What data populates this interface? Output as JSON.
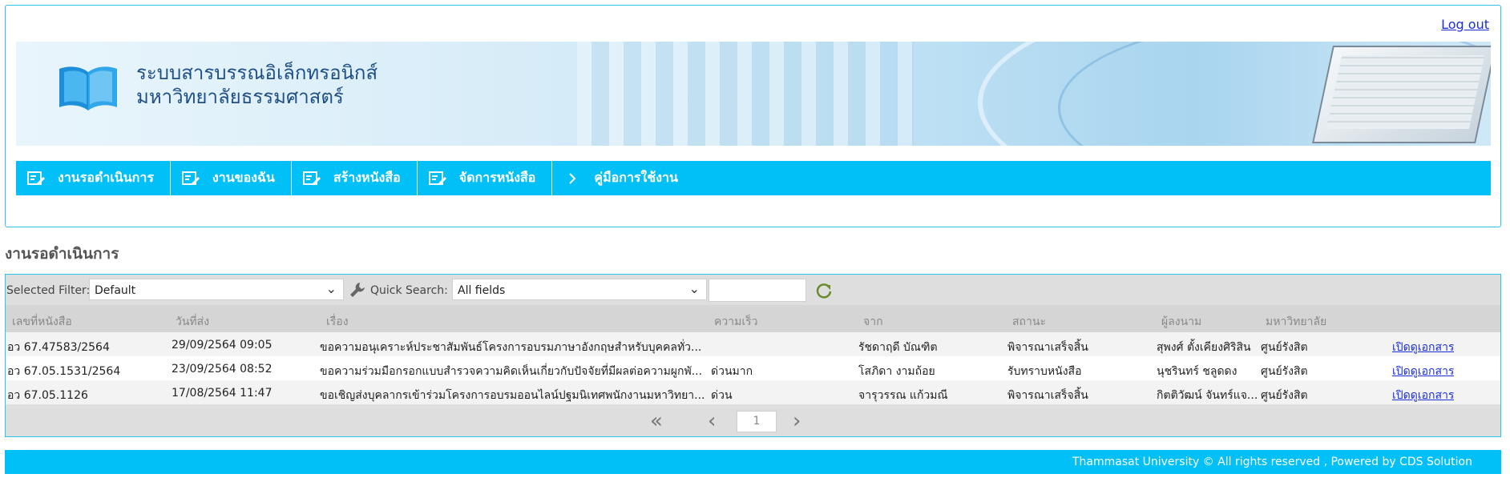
{
  "header": {
    "logout_label": "Log out",
    "banner_title_line1": "ระบบสารบรรณอิเล็กทรอนิกส์",
    "banner_title_line2": "มหาวิทยาลัยธรรมศาสตร์"
  },
  "nav": {
    "items": [
      {
        "label": "งานรอดำเนินการ",
        "icon": "document-edit-icon"
      },
      {
        "label": "งานของฉัน",
        "icon": "document-edit-icon"
      },
      {
        "label": "สร้างหนังสือ",
        "icon": "document-edit-icon"
      },
      {
        "label": "จัดการหนังสือ",
        "icon": "document-edit-icon"
      },
      {
        "label": "คู่มือการใช้งาน",
        "icon": "chevron-right-icon"
      }
    ]
  },
  "page": {
    "title": "งานรอดำเนินการ"
  },
  "toolbar": {
    "filter_label": "Selected Filter:",
    "filter_value": "Default",
    "quick_search_label": "Quick Search:",
    "quick_search_field": "All fields",
    "search_value": ""
  },
  "table": {
    "columns": [
      "เลขที่หนังสือ",
      "วันที่ส่ง",
      "เรื่อง",
      "ความเร็ว",
      "จาก",
      "สถานะ",
      "ผู้ลงนาม",
      "มหาวิทยาลัย"
    ],
    "rows": [
      {
        "doc_no": "อว 67.47583/2564",
        "date": "29/09/2564 09:05",
        "subject": "ขอความอนุเคราะห์ประชาสัมพันธ์โครงการอบรมภาษาอังกฤษสำหรับบุคคลทั่ว...",
        "speed": "",
        "from": "รัชดาฤดี บัณฑิต",
        "status": "พิจารณาเสร็จสิ้น",
        "signer": "สุพงศ์ ตั้งเคียงศิริสิน",
        "university": "ศูนย์รังสิต",
        "action": "เปิดดูเอกสาร"
      },
      {
        "doc_no": "อว 67.05.1531/2564",
        "date": "23/09/2564 08:52",
        "subject": "ขอความร่วมมือกรอกแบบสำรวจความคิดเห็นเกี่ยวกับปัจจัยที่มีผลต่อความผูกพั...",
        "speed": "ด่วนมาก",
        "from": "โสภิดา งามถ้อย",
        "status": "รับทราบหนังสือ",
        "signer": "นุชรินทร์ ชลูดดง",
        "university": "ศูนย์รังสิต",
        "action": "เปิดดูเอกสาร"
      },
      {
        "doc_no": "อว 67.05.1126",
        "date": "17/08/2564 11:47",
        "subject": "ขอเชิญส่งบุคลากรเข้าร่วมโครงการอบรมออนไลน์ปฐมนิเทศพนักงานมหาวิทยา...",
        "speed": "ด่วน",
        "from": "จารุวรรณ แก้วมณี",
        "status": "พิจารณาเสร็จสิ้น",
        "signer": "กิตติวัฒน์ จันทร์แจ...",
        "university": "ศูนย์รังสิต",
        "action": "เปิดดูเอกสาร"
      }
    ]
  },
  "pager": {
    "current_page": "1"
  },
  "footer": {
    "text": "Thammasat University © All rights reserved , Powered by CDS Solution"
  },
  "colors": {
    "accent": "#00c0f7",
    "border": "#2ec3e8",
    "link": "#1a2fd6"
  }
}
